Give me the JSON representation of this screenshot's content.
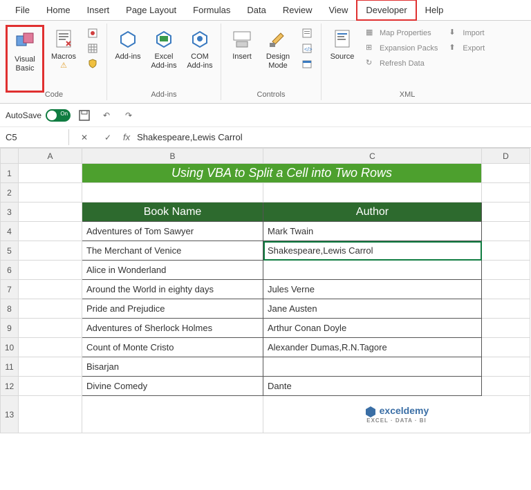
{
  "tabs": [
    "File",
    "Home",
    "Insert",
    "Page Layout",
    "Formulas",
    "Data",
    "Review",
    "View",
    "Developer",
    "Help"
  ],
  "active_tab": 8,
  "ribbon": {
    "code": {
      "label": "Code",
      "visual_basic": "Visual Basic",
      "macros": "Macros"
    },
    "addins": {
      "label": "Add-ins",
      "addins": "Add-ins",
      "excel": "Excel Add-ins",
      "com": "COM Add-ins"
    },
    "controls": {
      "label": "Controls",
      "insert": "Insert",
      "design": "Design Mode"
    },
    "xml": {
      "label": "XML",
      "source": "Source",
      "map": "Map Properties",
      "expansion": "Expansion Packs",
      "refresh": "Refresh Data",
      "import": "Import",
      "export": "Export"
    }
  },
  "qat": {
    "autosave": "AutoSave",
    "toggle": "On"
  },
  "namebox": "C5",
  "formula": "Shakespeare,Lewis Carrol",
  "cols": [
    "A",
    "B",
    "C",
    "D"
  ],
  "rows": [
    "1",
    "2",
    "3",
    "4",
    "5",
    "6",
    "7",
    "8",
    "9",
    "10",
    "11",
    "12",
    "13"
  ],
  "title": "Using VBA to Split a Cell into Two Rows",
  "headers": {
    "book": "Book Name",
    "author": "Author"
  },
  "data": [
    {
      "b": "Adventures of Tom Sawyer",
      "c": "Mark Twain"
    },
    {
      "b": "The Merchant of Venice",
      "c": "Shakespeare,Lewis Carrol"
    },
    {
      "b": "Alice in Wonderland",
      "c": ""
    },
    {
      "b": "Around the World in eighty days",
      "c": "Jules Verne"
    },
    {
      "b": "Pride and Prejudice",
      "c": "Jane Austen"
    },
    {
      "b": "Adventures of Sherlock Holmes",
      "c": "Arthur Conan Doyle"
    },
    {
      "b": "Count of Monte Cristo",
      "c": "Alexander Dumas,R.N.Tagore"
    },
    {
      "b": "Bisarjan",
      "c": ""
    },
    {
      "b": "Divine Comedy",
      "c": "Dante"
    }
  ],
  "logo": {
    "name": "exceldemy",
    "sub": "EXCEL · DATA · BI"
  }
}
